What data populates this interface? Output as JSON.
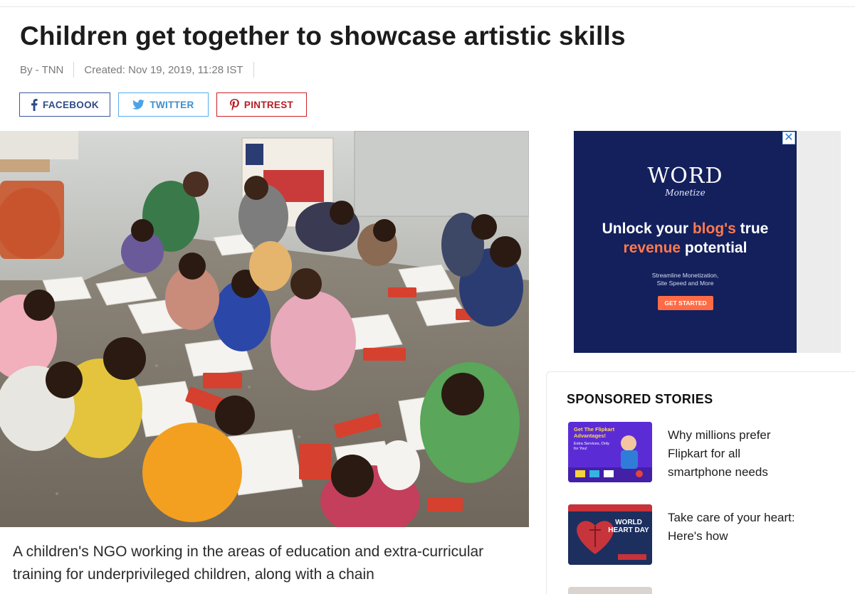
{
  "article": {
    "headline": "Children get together to showcase artistic skills",
    "byline": "By - TNN",
    "created": "Created: Nov 19, 2019, 11:28 IST",
    "body_first": "A children's NGO working in the areas of education and extra-curricular training for underprivileged children, along with a chain"
  },
  "share": {
    "facebook": "FACEBOOK",
    "twitter": "TWITTER",
    "pinterest": "PINTREST"
  },
  "ad": {
    "brand_main": "WORD",
    "brand_sub": "Monetize",
    "headline_part1": "Unlock your ",
    "headline_highlight1": "blog's",
    "headline_part2": " true",
    "headline_highlight2": "revenue",
    "headline_part3": " potential",
    "sub_line1": "Streamline Monetization,",
    "sub_line2": "Site Speed and More",
    "cta": "GET STARTED",
    "close": "✕"
  },
  "sponsored": {
    "title": "SPONSORED STORIES",
    "items": [
      {
        "text": "Why millions prefer Flipkart for all smartphone needs",
        "thumb_title": "Get The Flipkart Advantages!",
        "thumb_sub": "Extra Services, Only for You!"
      },
      {
        "text": "Take care of your heart: Here's how",
        "thumb_title": "WORLD HEART DAY"
      }
    ]
  },
  "colors": {
    "facebook": "#3b5998",
    "twitter": "#55acee",
    "pinterest": "#cb2027",
    "ad_bg": "#13205c",
    "ad_accent": "#ff7a4d"
  },
  "icons": [
    "facebook-icon",
    "twitter-icon",
    "pinterest-icon",
    "close-icon"
  ]
}
